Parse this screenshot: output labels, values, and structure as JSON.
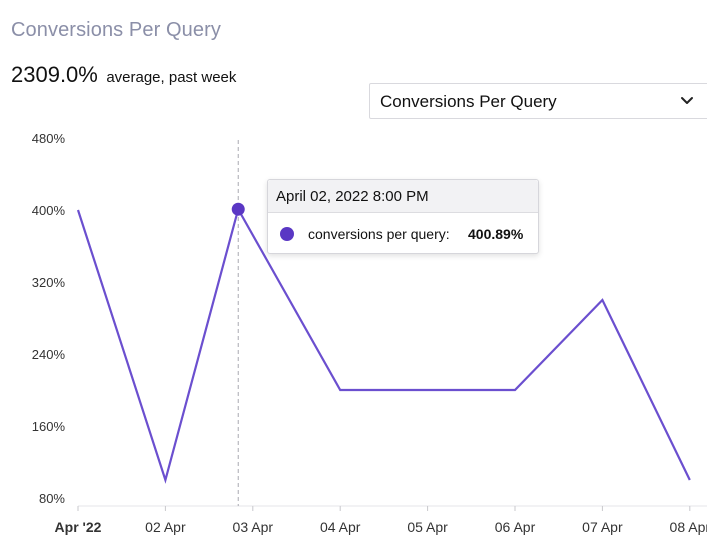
{
  "header": {
    "title": "Conversions Per Query",
    "summary_value": "2309.0%",
    "summary_caption": "average, past week"
  },
  "metric_select": {
    "selected": "Conversions Per Query"
  },
  "tooltip": {
    "timestamp": "April 02, 2022 8:00 PM",
    "series_label": "conversions per query:",
    "value": "400.89%"
  },
  "colors": {
    "line": "#6b4fcf",
    "point": "#5a37c4",
    "axis_text": "#333333",
    "title": "#8b8fa8"
  },
  "chart_data": {
    "type": "line",
    "title": "",
    "xlabel": "",
    "ylabel": "",
    "x": [
      "2022-04-01 00:00",
      "2022-04-02 00:00",
      "2022-04-02 20:00",
      "2022-04-04 00:00",
      "2022-04-06 00:00",
      "2022-04-07 00:00",
      "2022-04-08 00:00"
    ],
    "series": [
      {
        "values": [
          400,
          100,
          400.89,
          200,
          200,
          300,
          100
        ]
      }
    ],
    "highlighted_index": 2,
    "xticks": [
      "Apr '22",
      "02 Apr",
      "03 Apr",
      "04 Apr",
      "05 Apr",
      "06 Apr",
      "07 Apr",
      "08 Apr"
    ],
    "yticks": [
      "80%",
      "160%",
      "240%",
      "320%",
      "400%",
      "480%"
    ],
    "ylim": [
      80,
      480
    ],
    "grid": false,
    "legend": "none"
  }
}
